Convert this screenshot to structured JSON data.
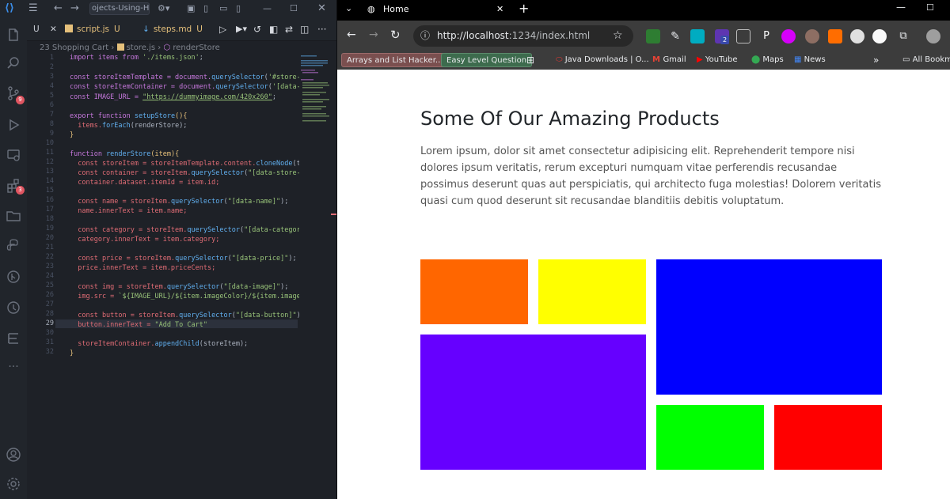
{
  "vscode": {
    "search_text": "ojects-Using-HTM",
    "tabs": [
      {
        "label": "U"
      },
      {
        "label": "script.js",
        "status": "U"
      },
      {
        "label": "steps.md",
        "status": "U"
      }
    ],
    "breadcrumb": {
      "folder": "23 Shopping Cart",
      "file": "store.js",
      "symbol": "renderStore"
    },
    "badges": {
      "source_control": "9",
      "extensions": "3"
    },
    "line_numbers": [
      "1",
      "2",
      "3",
      "4",
      "5",
      "6",
      "7",
      "8",
      "9",
      "10",
      "11",
      "12",
      "13",
      "14",
      "15",
      "16",
      "17",
      "18",
      "19",
      "20",
      "21",
      "22",
      "23",
      "24",
      "25",
      "26",
      "27",
      "28",
      "29",
      "30",
      "31",
      "32"
    ],
    "code": {
      "l1a": "import items from ",
      "l1b": "'./items.json'",
      "l1c": ";",
      "l3a": "const storeItemTemplate = document.",
      "l3b": "querySelector",
      "l3c": "(",
      "l3d": "'#store-ite",
      "l4a": "const storeItemContainer = document.",
      "l4b": "querySelector",
      "l4c": "(",
      "l4d": "'[data-sto",
      "l5a": "const IMAGE_URL = ",
      "l5b": "\"https://dummyimage.com/420x260\"",
      "l5c": ";",
      "l7a": "export function ",
      "l7b": "setupStore",
      "l7c": "(){",
      "l8a": "  items.",
      "l8b": "forEach",
      "l8c": "(renderStore);",
      "l9": "}",
      "l11a": "function ",
      "l11b": "renderStore",
      "l11c": "(item){",
      "l12a": "  const storeItem = storeItemTemplate.content.",
      "l12b": "cloneNode",
      "l12c": "(true",
      "l13a": "  const container = storeItem.",
      "l13b": "querySelector",
      "l13c": "(",
      "l13d": "\"[data-store-item]",
      "l14": "  container.dataset.itemId = item.id;",
      "l16a": "  const name = storeItem.",
      "l16b": "querySelector",
      "l16c": "(",
      "l16d": "\"[data-name]\"",
      "l16e": ");",
      "l17": "  name.innerText = item.name;",
      "l19a": "  const category = storeItem.",
      "l19b": "querySelector",
      "l19c": "(",
      "l19d": "\"[data-category]\"",
      "l19e": ");",
      "l20": "  category.innerText = item.category;",
      "l22a": "  const price = storeItem.",
      "l22b": "querySelector",
      "l22c": "(",
      "l22d": "\"[data-price]\"",
      "l22e": ");",
      "l23": "  price.innerText = item.priceCents;",
      "l25a": "  const img = storeItem.",
      "l25b": "querySelector",
      "l25c": "(",
      "l25d": "\"[data-image]\"",
      "l25e": ");",
      "l26a": "  img.src = ",
      "l26b": "`${IMAGE_URL}/${item.imageColor}/${item.imageCo",
      "l28a": "  const button = storeItem.",
      "l28b": "querySelector",
      "l28c": "(",
      "l28d": "\"[data-button]\"",
      "l28e": ");",
      "l29a": "  button.innerText = ",
      "l29b": "\"Add To Cart\"",
      "l31a": "  storeItemContainer.",
      "l31b": "appendChild",
      "l31c": "(storeItem);",
      "l32": "}"
    }
  },
  "browser": {
    "tab_title": "Home",
    "url_host": "http://localhost",
    "url_rest": ":1234/index.html",
    "extension_badge": "2",
    "bookmarks": {
      "b1": "Arrays and List Hacker...",
      "b2": "Easy Level Question",
      "b3": "Java Downloads | O...",
      "b4": "Gmail",
      "b5": "YouTube",
      "b6": "Maps",
      "b7": "News",
      "overflow": "»",
      "all": "All Bookm"
    },
    "page": {
      "heading": "Some Of Our Amazing Products",
      "paragraph": "Lorem ipsum, dolor sit amet consectetur adipisicing elit. Reprehenderit tempore nisi dolores ipsum veritatis, rerum excepturi numquam vitae perferendis recusandae possimus deserunt quas aut perspiciatis, qui architecto fuga molestias! Dolorem veritatis quasi cum quod deserunt sit recusandae blanditiis debitis voluptatum."
    },
    "product_colors": [
      "#ff6600",
      "#ffff00",
      "#0000ff",
      "#6600ff",
      "#00ff00",
      "#ff0000"
    ]
  },
  "colors": {
    "editor_bg": "#1e2127",
    "browser_chrome": "#3c3c3c",
    "accent": "#61afef"
  }
}
